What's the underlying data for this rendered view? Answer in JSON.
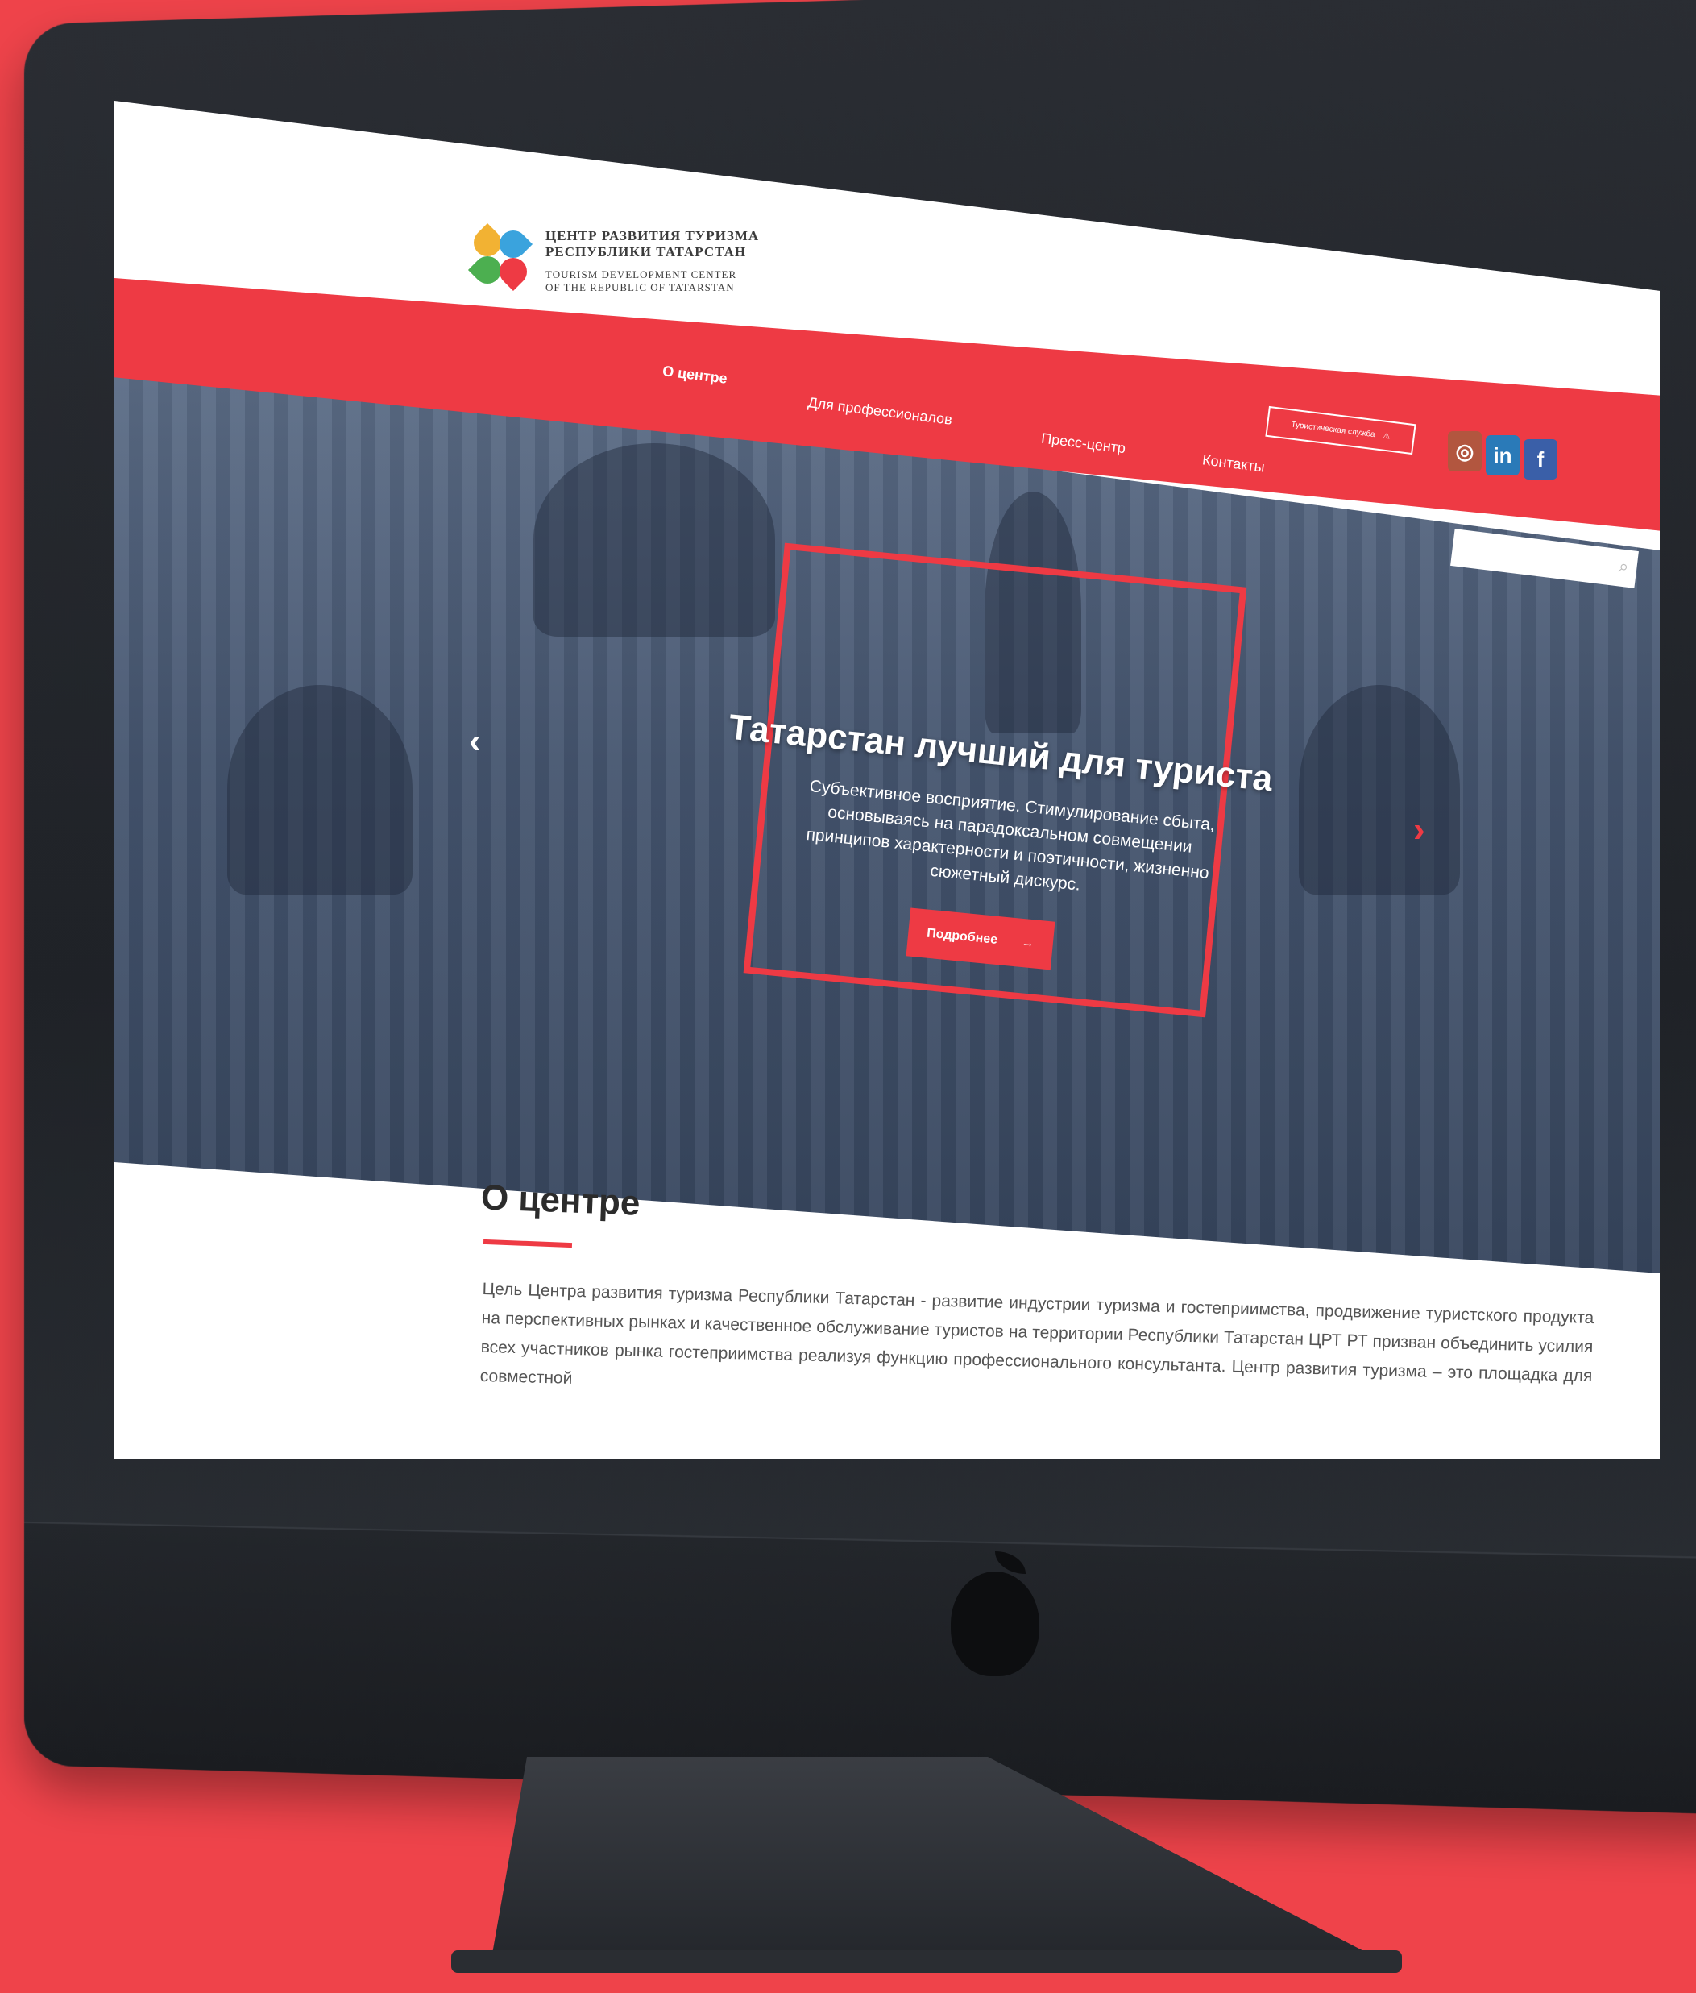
{
  "site": {
    "logo": {
      "ru_line1": "ЦЕНТР РАЗВИТИЯ ТУРИЗМА",
      "ru_line2": "РЕСПУБЛИКИ ТАТАРСТАН",
      "en_line1": "TOURISM DEVELOPMENT CENTER",
      "en_line2": "OF THE REPUBLIC OF TATARSTAN"
    },
    "nav": [
      {
        "label": "О центре"
      },
      {
        "label": "Для профессионалов"
      },
      {
        "label": "Пресс-центр"
      },
      {
        "label": "Контакты"
      }
    ],
    "service_button": "Туристическая служба",
    "socials": [
      "instagram-icon",
      "linkedin-icon",
      "facebook-icon"
    ],
    "search": {
      "placeholder": ""
    }
  },
  "hero": {
    "title": "Татарстан лучший для туриста",
    "description": "Субъективное восприятие. Стимулирование сбыта, основываясь на парадоксальном совмещении принципов характерности и поэтичности, жизненно сюжетный дискурс.",
    "button": "Подробнее",
    "button_arrow": "→",
    "prev_arrow": "‹",
    "next_arrow": "›"
  },
  "about": {
    "title": "О центре",
    "text": "Цель Центра развития туризма Республики Татарстан - развитие индустрии туризма и гостеприимства, продвижение туристского продукта на перспективных рынках и качественное обслуживание туристов на территории Республики Татарстан ЦРТ РТ призван объединить усилия всех участников рынка гостеприимства реализуя функцию профессионального консультанта. Центр развития туризма – это площадка для совместной"
  },
  "colors": {
    "accent": "#ee3a44",
    "background": "#ef434a",
    "hero_overlay": "#45556f"
  }
}
